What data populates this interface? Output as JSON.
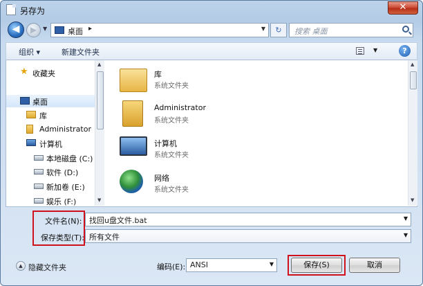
{
  "window": {
    "title": "另存为",
    "close_label": "✕"
  },
  "nav": {
    "back_glyph": "◀",
    "forward_glyph": "▶",
    "address_location": "桌面",
    "address_separator": "▸",
    "refresh_glyph": "↻",
    "search_placeholder": "搜索 桌面"
  },
  "toolbar": {
    "organize_label": "组织 ▾",
    "new_folder_label": "新建文件夹",
    "help_label": "?"
  },
  "sidebar": {
    "items": [
      {
        "label": "收藏夹",
        "icon": "star-icon"
      },
      {
        "label": "桌面",
        "icon": "desktop-icon",
        "selected": true
      },
      {
        "label": "库",
        "icon": "library-icon"
      },
      {
        "label": "Administrator",
        "icon": "user-icon"
      },
      {
        "label": "计算机",
        "icon": "computer-icon"
      },
      {
        "label": "本地磁盘 (C:)",
        "icon": "drive-icon"
      },
      {
        "label": "软件 (D:)",
        "icon": "drive-icon"
      },
      {
        "label": "新加卷 (E:)",
        "icon": "drive-icon"
      },
      {
        "label": "娱乐 (F:)",
        "icon": "drive-icon"
      }
    ]
  },
  "files": [
    {
      "name": "库",
      "type": "系统文件夹",
      "icon": "library-icon"
    },
    {
      "name": "Administrator",
      "type": "系统文件夹",
      "icon": "user-folder-icon"
    },
    {
      "name": "计算机",
      "type": "系统文件夹",
      "icon": "computer-icon"
    },
    {
      "name": "网络",
      "type": "系统文件夹",
      "icon": "network-icon"
    }
  ],
  "form": {
    "filename_label": "文件名(N):",
    "filename_value": "找回u盘文件.bat",
    "filetype_label": "保存类型(T):",
    "filetype_value": "所有文件",
    "encoding_label": "编码(E):",
    "encoding_value": "ANSI"
  },
  "footer": {
    "hide_folders_label": "隐藏文件夹",
    "save_label": "保存(S)",
    "cancel_label": "取消"
  },
  "colors": {
    "highlight_red": "#d0101a",
    "selection_blue": "#d5e7fb"
  }
}
